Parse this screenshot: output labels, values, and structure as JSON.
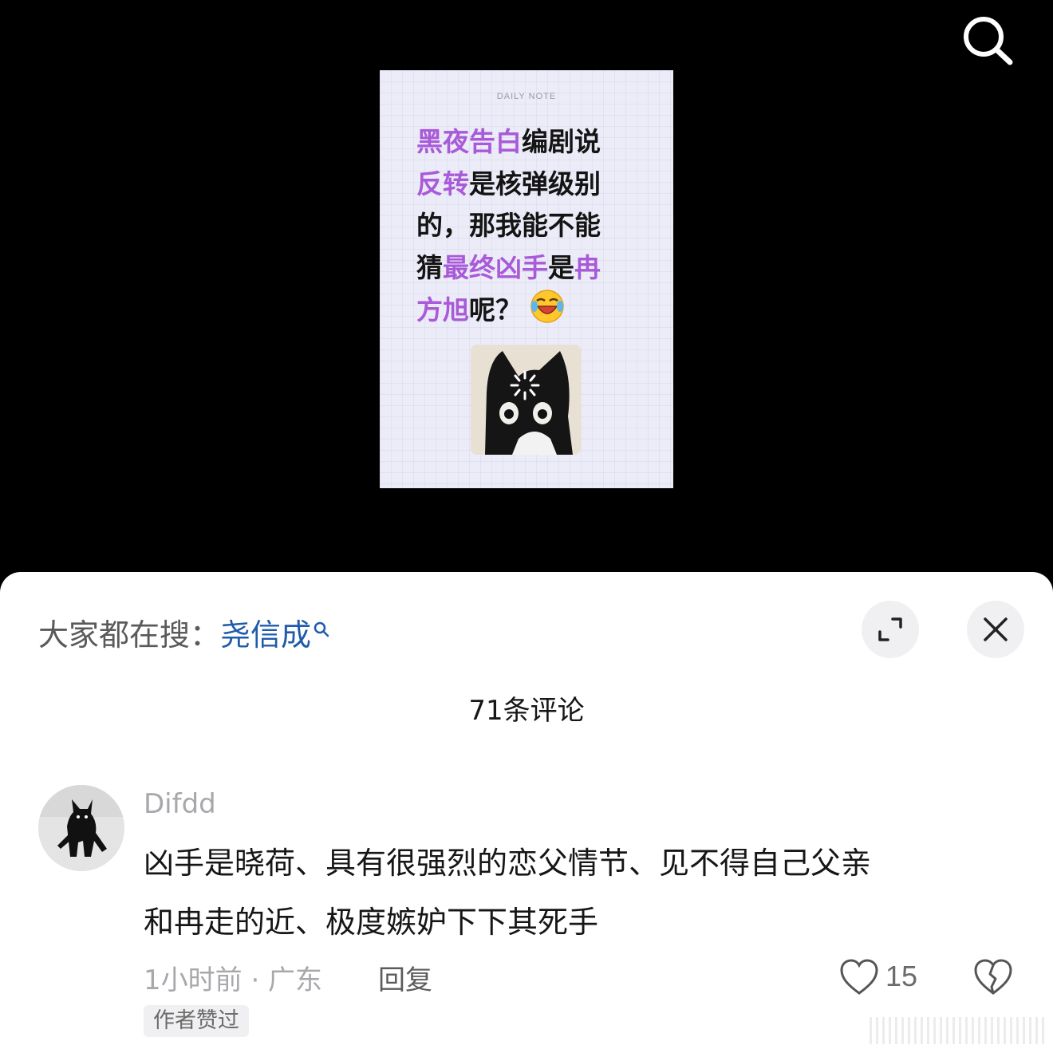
{
  "video": {
    "note_header": "DAILY NOTE",
    "note_lines": [
      [
        "黑夜告白",
        "编剧说"
      ],
      [
        "反转",
        "是核弹级别"
      ],
      [
        "",
        "的，那我能不能"
      ],
      [
        "最终凶手",
        "是",
        "冉"
      ],
      [
        "方旭",
        "呢？"
      ]
    ],
    "line4_prefix": "猜",
    "icons": {
      "search": "search-icon",
      "emoji": "laughing-crying-emoji-icon",
      "cat": "cat-loading-photo"
    }
  },
  "sheet": {
    "hot_search_prefix": "大家都在搜：",
    "hot_search_keyword": "尧信成",
    "title": "71条评论",
    "expand_icon": "expand-icon",
    "close_icon": "close-icon"
  },
  "comment": {
    "username": "Difdd",
    "text_line1": "凶手是晓荷、具有很强烈的恋父情节、见不得自己父亲",
    "text_line2": "和冉走的近、极度嫉妒下下其死手",
    "time_location": "1小时前 · 广东",
    "reply_label": "回复",
    "likes": "15",
    "badge": "作者赞过",
    "icons": {
      "like": "heart-icon",
      "dislike": "broken-heart-icon"
    }
  },
  "colors": {
    "highlight": "#a85ad8",
    "keyword": "#1f5bab",
    "text": "#161616",
    "muted": "#a8a8ac"
  }
}
